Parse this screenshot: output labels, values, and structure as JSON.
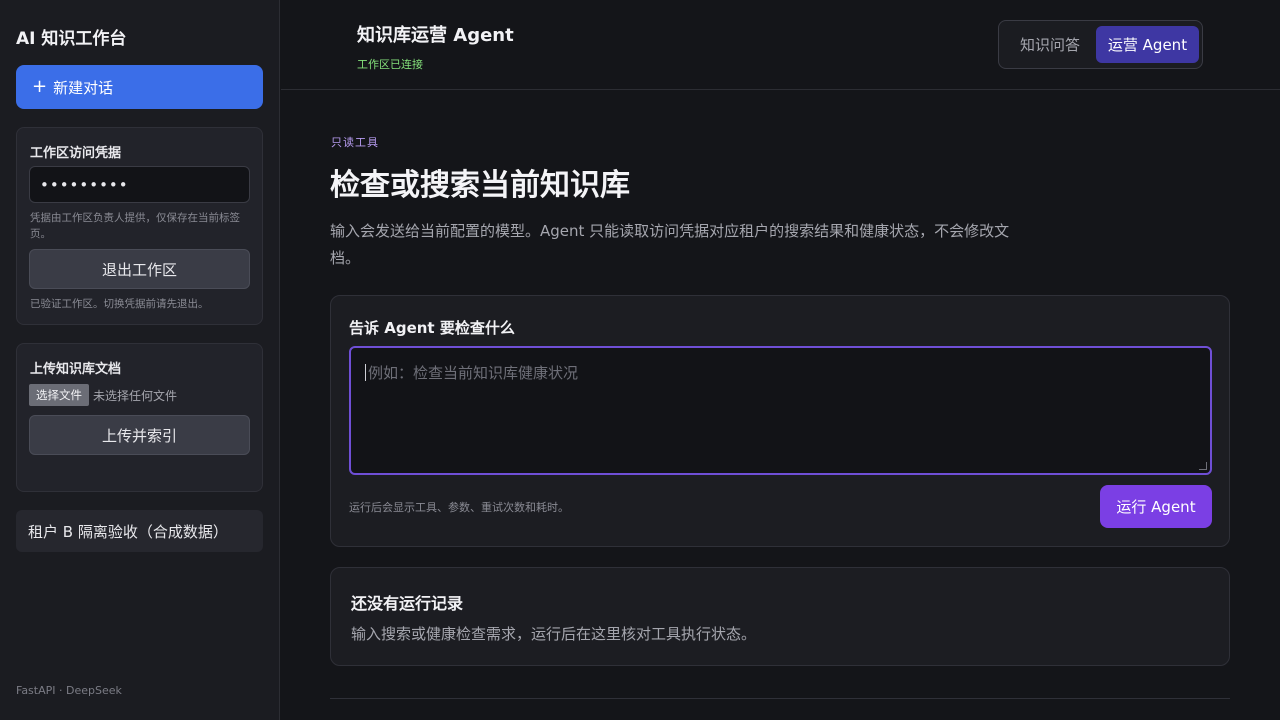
{
  "sidebar": {
    "brand": "AI 知识工作台",
    "new_chat_label": "新建对话",
    "credential_panel": {
      "title": "工作区访问凭据",
      "password_value": "•••••••••",
      "note": "凭据由工作区负责人提供，仅保存在当前标签页。",
      "logout_label": "退出工作区",
      "verified_note": "已验证工作区。切换凭据前请先退出。"
    },
    "upload_panel": {
      "title": "上传知识库文档",
      "choose_file_label": "选择文件",
      "file_status": "未选择任何文件",
      "upload_label": "上传并索引"
    },
    "tenant_item": "租户 B 隔离验收（合成数据）",
    "footer": "FastAPI · DeepSeek"
  },
  "header": {
    "title": "知识库运营 Agent",
    "status": "工作区已连接",
    "modes": [
      "知识问答",
      "运营 Agent"
    ],
    "active_mode": "运营 Agent"
  },
  "main": {
    "eyebrow": "只读工具",
    "title": "检查或搜索当前知识库",
    "description": "输入会发送给当前配置的模型。Agent 只能读取访问凭据对应租户的搜索结果和健康状态，不会修改文档。",
    "form": {
      "label": "告诉 Agent 要检查什么",
      "placeholder": "例如：检查当前知识库健康状况",
      "run_note": "运行后会显示工具、参数、重试次数和耗时。",
      "run_label": "运行 Agent"
    },
    "empty_state": {
      "title": "还没有运行记录",
      "description": "输入搜索或健康检查需求，运行后在这里核对工具执行状态。"
    }
  },
  "colors": {
    "primary_blue": "#3b6ee8",
    "accent_purple": "#7b3fe4",
    "active_tab": "#3e37a3",
    "status_green": "#84e07a"
  }
}
